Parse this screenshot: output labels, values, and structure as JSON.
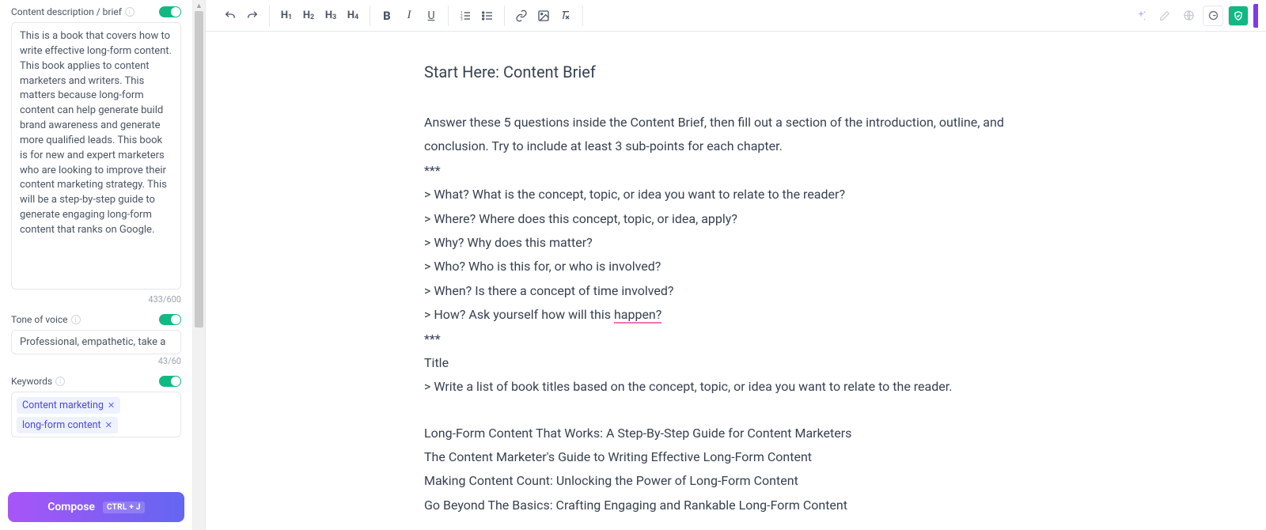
{
  "sidebar": {
    "brief": {
      "label": "Content description / brief",
      "text": "This is a book that covers how to write effective long-form content. This book applies to content marketers and writers. This matters because long-form content can help generate build brand awareness and generate more qualified leads. This book is for new and expert marketers who are looking to improve their content marketing strategy. This will be a step-by-step guide to generate engaging long-form content that ranks on Google.",
      "counter": "433/600"
    },
    "tone": {
      "label": "Tone of voice",
      "value": "Professional, empathetic, take a",
      "counter": "43/60"
    },
    "keywords": {
      "label": "Keywords",
      "tags": [
        "Content marketing",
        "long-form content"
      ]
    },
    "compose": {
      "label": "Compose",
      "shortcut": "CTRL + J"
    }
  },
  "toolbar": {
    "h1": "H",
    "h2": "H",
    "h3": "H",
    "h4": "H"
  },
  "doc": {
    "title": "Start Here: Content Brief",
    "intro": "Answer these 5 questions inside the Content Brief, then fill out a section of the introduction, outline, and conclusion. Try to include at least 3 sub-points for each chapter.",
    "sep": "***",
    "q1": "> What? What is the concept, topic, or idea you want to relate to the reader?",
    "q2": "> Where? Where does this concept, topic, or idea, apply?",
    "q3": "> Why? Why does this matter?",
    "q4": "> Who? Who is this for, or who is involved?",
    "q5": "> When? Is there a concept of time involved?",
    "q6a": "> How? Ask yourself how will this ",
    "q6b": "happen?",
    "sep2": "***",
    "titleLabel": "Title",
    "titlePrompt": "> Write a list of book titles based on the concept, topic, or idea you want to relate to the reader.",
    "t1": "Long-Form Content That Works: A Step-By-Step Guide for Content Marketers",
    "t2": "The Content Marketer's Guide to Writing Effective Long-Form Content",
    "t3": "Making Content Count: Unlocking the Power of Long-Form Content",
    "t4": "Go Beyond The Basics: Crafting Engaging and Rankable Long-Form Content"
  }
}
